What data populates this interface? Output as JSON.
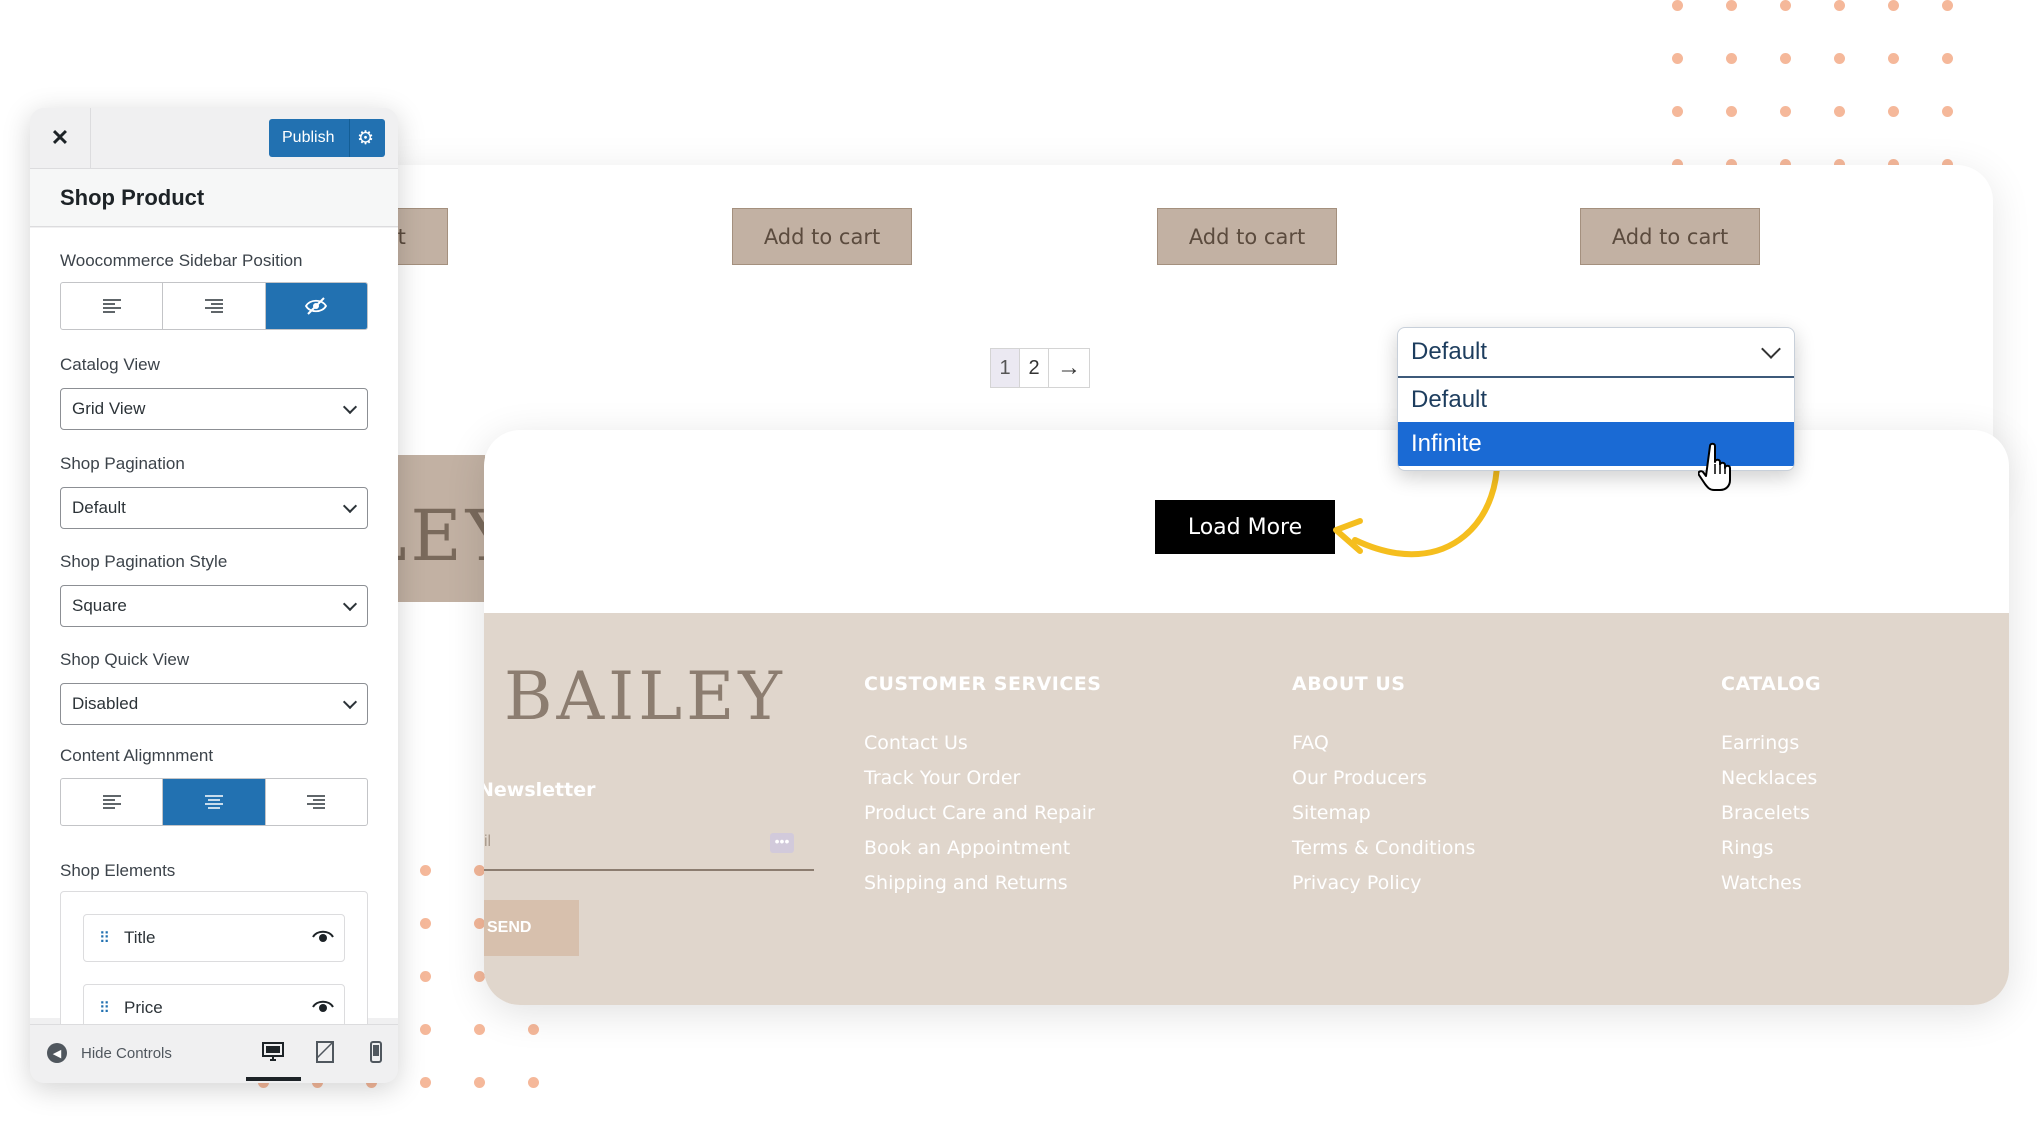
{
  "shop": {
    "cart_buttons": [
      "o cart",
      "Add to cart",
      "Add to cart",
      "Add to cart"
    ],
    "pagination": [
      "1",
      "2",
      "→"
    ],
    "load_more_label": "Load More"
  },
  "dropdown": {
    "selected": "Default",
    "options": [
      "Default",
      "Infinite"
    ],
    "highlighted": "Infinite"
  },
  "footer": {
    "brand": "BAILEY",
    "newsletter_title": "Newsletter",
    "email_placeholder": "il",
    "send_label": "SEND",
    "columns": [
      {
        "title": "CUSTOMER SERVICES",
        "links": [
          "Contact Us",
          "Track Your Order",
          "Product Care and Repair",
          "Book an Appointment",
          "Shipping and Returns"
        ]
      },
      {
        "title": "ABOUT US",
        "links": [
          "FAQ",
          "Our Producers",
          "Sitemap",
          "Terms & Conditions",
          "Privacy Policy"
        ]
      },
      {
        "title": "CATALOG",
        "links": [
          "Earrings",
          "Necklaces",
          "Bracelets",
          "Rings",
          "Watches"
        ]
      }
    ]
  },
  "logo_partial": "LEY",
  "customizer": {
    "publish_label": "Publish",
    "section_title": "Shop Product",
    "sidebar_position_label": "Woocommerce Sidebar Position",
    "catalog_view_label": "Catalog View",
    "catalog_view_value": "Grid View",
    "pagination_label": "Shop Pagination",
    "pagination_value": "Default",
    "pagination_style_label": "Shop Pagination Style",
    "pagination_style_value": "Square",
    "quick_view_label": "Shop Quick View",
    "quick_view_value": "Disabled",
    "content_alignment_label": "Content Aligmnment",
    "elements_label": "Shop Elements",
    "elements": [
      "Title",
      "Price"
    ],
    "hide_controls_label": "Hide Controls"
  },
  "colors": {
    "accent_blue": "#2271b1",
    "dropdown_highlight": "#1a6ad4",
    "footer_bg": "#e0d6cc",
    "cart_button": "#c2b1a3",
    "dot_color": "#f5b89a",
    "arrow_color": "#f5be1e"
  }
}
